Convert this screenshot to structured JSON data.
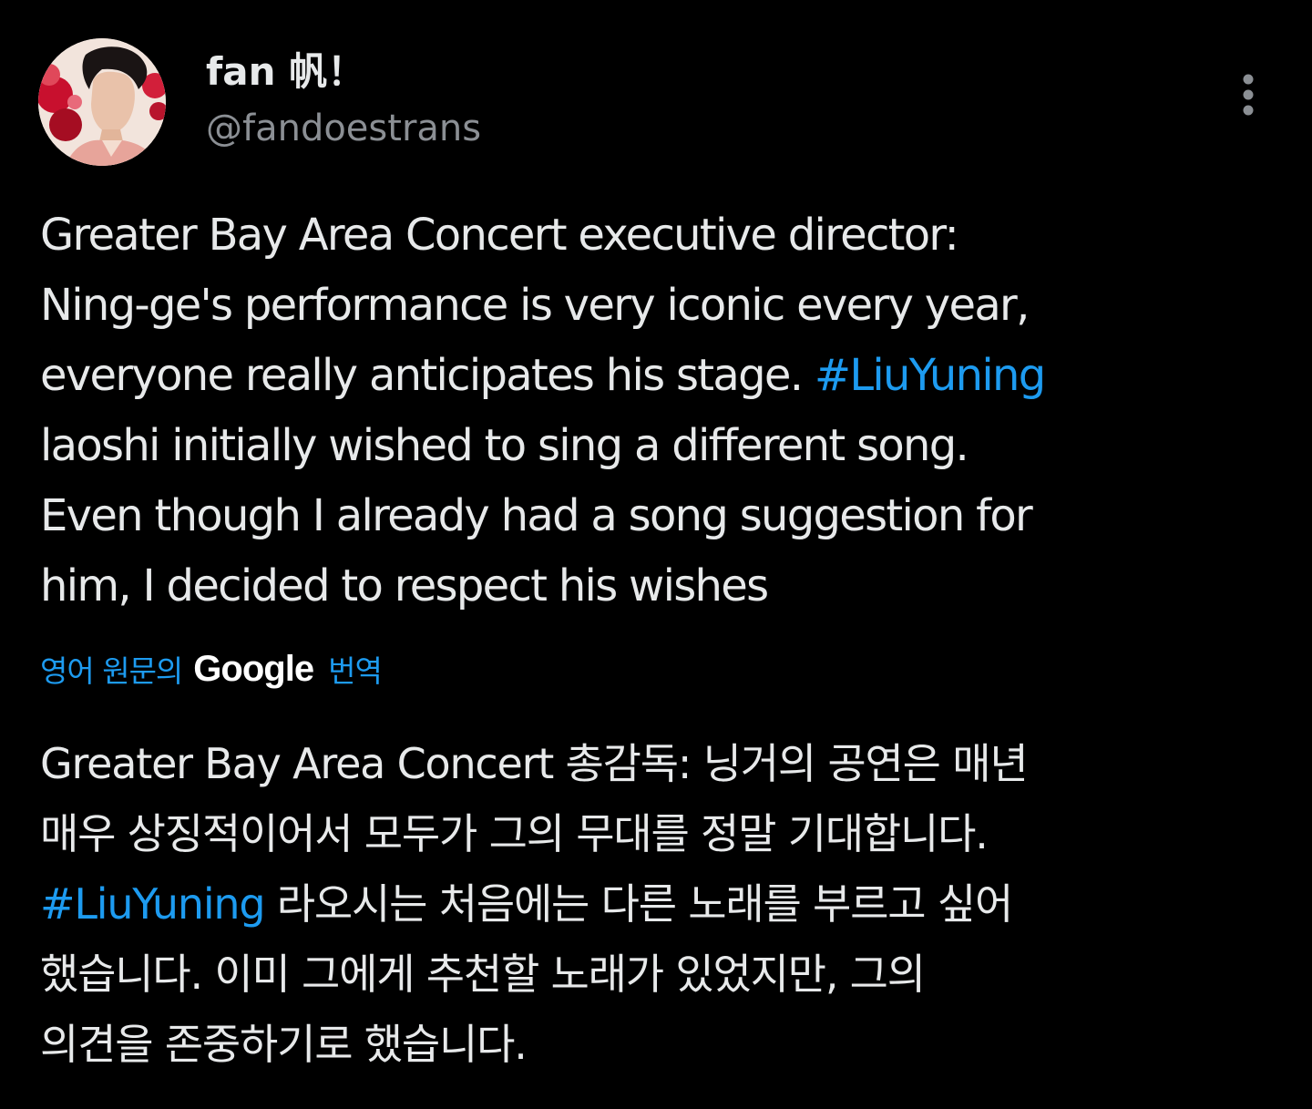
{
  "tweet": {
    "author": {
      "display_name": "fan 帆！",
      "handle": "@fandoestrans"
    },
    "text_lines": [
      "Greater Bay Area Concert executive director:",
      "Ning-ge's  performance is very iconic every year,",
      "everyone really anticipates his stage. ",
      "laoshi initially wished to sing a different song.",
      "Even though I already had a song suggestion for",
      "him, I decided to respect his wishes"
    ],
    "hashtag": "#LiuYuning",
    "translation": {
      "prefix": "영어 원문의",
      "brand": "Google",
      "suffix": "번역"
    },
    "translated_lines": [
      "Greater Bay Area Concert 총감독: 닝거의 공연은 매년",
      "매우 상징적이어서 모두가 그의 무대를 정말 기대합니다.",
      " 라오시는 처음에는 다른 노래를 부르고 싶어",
      "했습니다. 이미 그에게 추천할 노래가 있었지만, 그의",
      "의견을 존중하기로 했습니다."
    ],
    "colors": {
      "background": "#000000",
      "text": "#e7e9ea",
      "secondary": "#8b8f94",
      "link": "#1d9bf0"
    },
    "icons": {
      "more": "more-vertical-icon",
      "avatar": "profile-photo"
    }
  }
}
